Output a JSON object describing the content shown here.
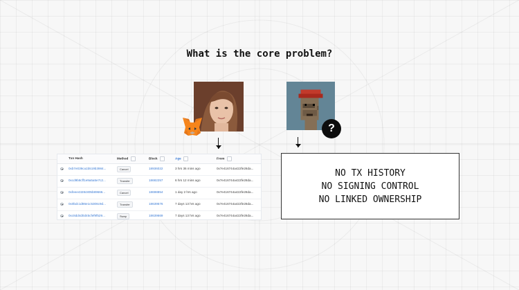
{
  "slide": {
    "title": "What is the core problem?"
  },
  "icons": {
    "wallet": "metamask-fox-icon",
    "help": "question-mark-icon"
  },
  "question_badge": "?",
  "tx_table": {
    "headers": {
      "hash": "Txn Hash",
      "method": "Method",
      "block": "Block",
      "age": "Age",
      "from": "From"
    },
    "rows": [
      {
        "hash": "0xb7e039ca1b519b3984...",
        "method": "Cancel",
        "block": "18936022",
        "age": "3 hrs 36 mins ago",
        "from": "0x7e416744a422fe28da..."
      },
      {
        "hash": "0xcd9b8cff1e9a5a5e7c2...",
        "method": "Transfer",
        "block": "18682257",
        "age": "6 hrs 12 mins ago",
        "from": "0x7e416744a422fe28da..."
      },
      {
        "hash": "0xfeee4328c805b89666...",
        "method": "Cancel",
        "block": "18698854",
        "age": "1 day 2 hrs ago",
        "from": "0x7e416744a422fe28da..."
      },
      {
        "hash": "0x0bdc1d86e1c5306c9d...",
        "method": "Transfer",
        "block": "18639576",
        "age": "7 days 13 hrs ago",
        "from": "0x7e416744a422fe28da..."
      },
      {
        "hash": "0xc8dd4d0d45cfef9f529...",
        "method": "Swap",
        "block": "18639669",
        "age": "7 days 13 hrs ago",
        "from": "0x7e416744a422fe28da..."
      }
    ]
  },
  "problems": [
    "NO TX HISTORY",
    "NO SIGNING CONTROL",
    "NO LINKED OWNERSHIP"
  ]
}
